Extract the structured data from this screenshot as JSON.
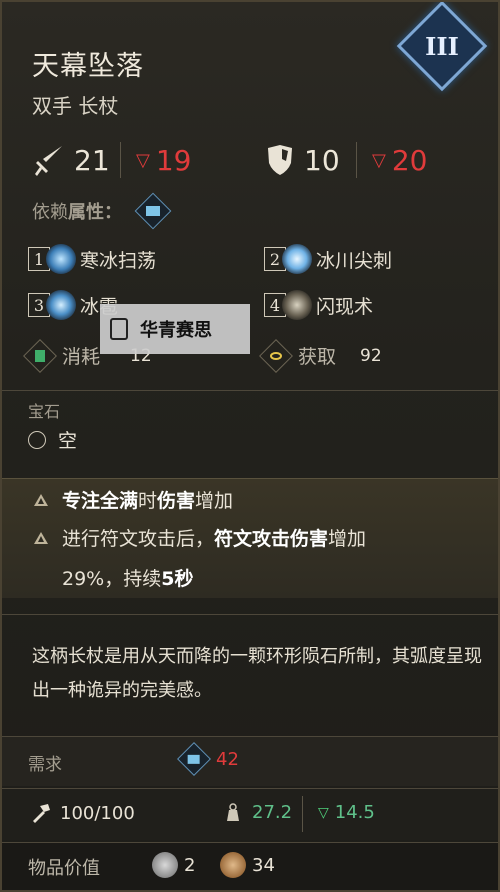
{
  "item": {
    "name": "天幕坠落",
    "type": "双手 长杖",
    "rank": "III"
  },
  "stats": {
    "attack": "21",
    "attack_req": "19",
    "defense": "10",
    "defense_req": "20"
  },
  "dependency": {
    "label_prefix": "依赖",
    "label_bold": "属性：",
    "icon": "book-icon"
  },
  "skills": [
    {
      "num": "1",
      "name": "寒冰扫荡",
      "icon": "ice-sweep-icon"
    },
    {
      "num": "2",
      "name": "冰川尖刺",
      "icon": "glacier-spike-icon"
    },
    {
      "num": "3",
      "name": "冰雹",
      "icon": "hail-icon"
    },
    {
      "num": "4",
      "name": "闪现术",
      "icon": "blink-icon"
    }
  ],
  "costs": {
    "consume_label": "消耗",
    "consume_value": "12",
    "gain_label": "获取",
    "gain_value": "92"
  },
  "gem": {
    "title": "宝石",
    "slot": "空"
  },
  "perks": {
    "p1_a": "专注全满",
    "p1_b": "时",
    "p1_c": "伤害",
    "p1_d": "增加",
    "p2_a": "进行符文攻击后，",
    "p2_b": "符文攻击伤害",
    "p2_c": "增加",
    "p2_d": "29%，持续",
    "p2_e": "5秒"
  },
  "lore": "这柄长杖是用从天而降的一颗环形陨石所制，其弧度呈现出一种诡异的完美感。",
  "requirement": {
    "label": "需求",
    "value": "42"
  },
  "durability": {
    "value": "100/100",
    "weight": "27.2",
    "weight_req": "14.5"
  },
  "value": {
    "label": "物品价值",
    "silver": "2",
    "gold": "34"
  },
  "overlay": {
    "text": "华青赛思"
  },
  "colors": {
    "accent_red": "#e03b3b",
    "accent_green": "#4fd07b",
    "rank_blue": "#1c3350"
  }
}
